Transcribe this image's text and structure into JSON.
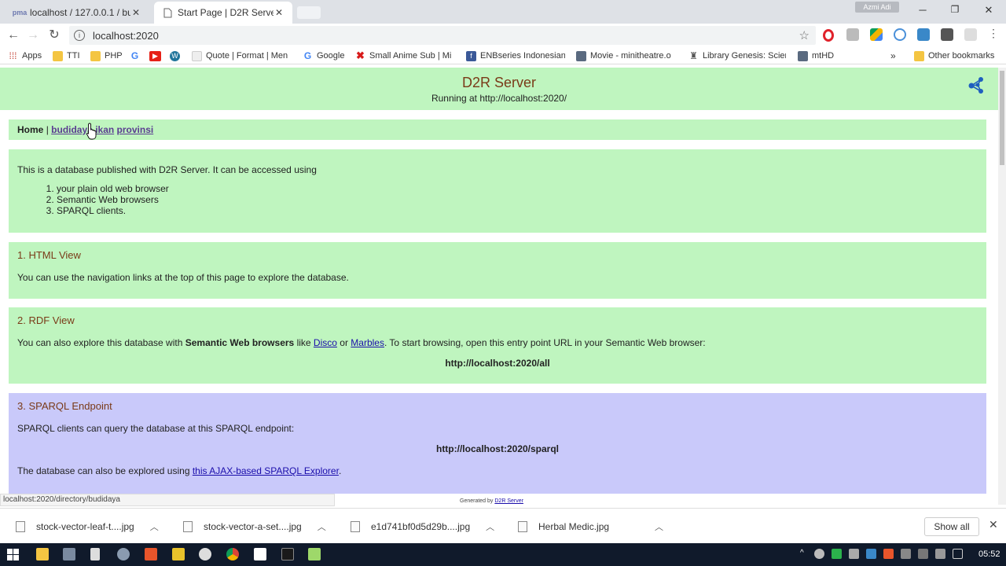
{
  "browser": {
    "tabs": [
      {
        "title": "localhost / 127.0.0.1 / bu",
        "active": false
      },
      {
        "title": "Start Page | D2R Server",
        "active": true
      }
    ],
    "profile_label": "Azmi Adi",
    "url": "localhost:2020",
    "bookmarks": [
      {
        "label": "Apps",
        "icon": "apps-grid-icon",
        "color": "#c0392b"
      },
      {
        "label": "TTI",
        "icon": "folder-icon",
        "color": "#f4c542"
      },
      {
        "label": "PHP",
        "icon": "folder-icon",
        "color": "#f4c542"
      },
      {
        "label": "",
        "icon": "google-icon",
        "color": "#4285f4"
      },
      {
        "label": "",
        "icon": "youtube-icon",
        "color": "#e62117"
      },
      {
        "label": "",
        "icon": "wordpress-icon",
        "color": "#21759b"
      },
      {
        "label": "Quote | Format | Men",
        "icon": "page-icon",
        "color": "#dddddd"
      },
      {
        "label": "Google",
        "icon": "google-icon",
        "color": "#4285f4"
      },
      {
        "label": "Small Anime Sub | Mi",
        "icon": "x-icon",
        "color": "#d81b1b"
      },
      {
        "label": "ENBseries Indonesian",
        "icon": "facebook-icon",
        "color": "#3b5998"
      },
      {
        "label": "Movie - minitheatre.o",
        "icon": "movie-icon",
        "color": "#5a6a80"
      },
      {
        "label": "Library Genesis: Scien",
        "icon": "library-icon",
        "color": "#555555"
      },
      {
        "label": "mtHD",
        "icon": "movie-icon",
        "color": "#5a6a80"
      },
      {
        "label": "Other bookmarks",
        "icon": "folder-icon",
        "color": "#f4c542"
      }
    ],
    "status_url": "localhost:2020/directory/budidaya"
  },
  "page": {
    "title": "D2R Server",
    "running": "Running at http://localhost:2020/",
    "nav": {
      "home": "Home",
      "separator": "|",
      "links": [
        "budidaya",
        "ikan",
        "provinsi"
      ]
    },
    "intro": {
      "text": "This is a database published with D2R Server. It can be accessed using",
      "items": [
        "your plain old web browser",
        "Semantic Web browsers",
        "SPARQL clients."
      ]
    },
    "html_view": {
      "heading": "1. HTML View",
      "text": "You can use the navigation links at the top of this page to explore the database."
    },
    "rdf_view": {
      "heading": "2. RDF View",
      "text_pre": "You can also explore this database with",
      "bold": "Semantic Web browsers",
      "like": "like",
      "link1": "Disco",
      "or": "or",
      "link2": "Marbles",
      "text_post": ". To start browsing, open this entry point URL in your Semantic Web browser:",
      "url": "http://localhost:2020/all"
    },
    "sparql": {
      "heading": "3. SPARQL Endpoint",
      "text": "SPARQL clients can query the database at this SPARQL endpoint:",
      "url": "http://localhost:2020/sparql",
      "explore_pre": "The database can also be explored using",
      "explore_link": "this AJAX-based SPARQL Explorer",
      "explore_post": "."
    },
    "footer": {
      "generated": "Generated by",
      "link": "D2R Server"
    }
  },
  "downloads": {
    "items": [
      "stock-vector-leaf-t....jpg",
      "stock-vector-a-set....jpg",
      "e1d741bf0d5d29b....jpg",
      "Herbal Medic.jpg"
    ],
    "show_all": "Show all"
  },
  "taskbar": {
    "time": "05:52"
  },
  "colors": {
    "green_box": "#bff5bf",
    "purple_box": "#c9c9fa",
    "heading": "#7a3a18",
    "taskbar": "#101a2b"
  }
}
